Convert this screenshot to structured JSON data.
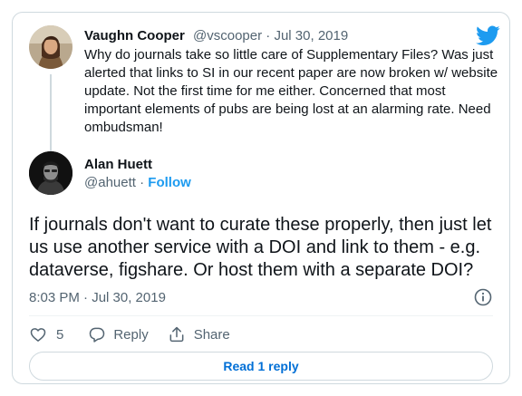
{
  "parent_tweet": {
    "name": "Vaughn Cooper",
    "handle": "@vscooper",
    "separator": " · ",
    "date": "Jul 30, 2019",
    "text": "Why do journals take so little care of Supplementary Files? Was just alerted that links to SI in our recent paper are now broken w/ website update. Not the first time for me either. Concerned that most important elements of pubs are being lost at an alarming rate. Need ombudsman!"
  },
  "main_tweet": {
    "name": "Alan Huett",
    "handle": "@ahuett",
    "separator": " · ",
    "follow_label": "Follow",
    "text": "If journals don't want to curate these properly, then just let us use another service with a DOI and link to them - e.g. dataverse, figshare. Or host them with a separate DOI?",
    "timestamp": "8:03 PM · Jul 30, 2019"
  },
  "actions": {
    "like_count": "5",
    "reply_label": "Reply",
    "share_label": "Share"
  },
  "read_replies_label": "Read 1 reply",
  "colors": {
    "brand_blue": "#1d9bf0",
    "link_blue": "#006fd6",
    "muted_text": "#536471",
    "border": "#cfd9de"
  },
  "icons": {
    "brand": "twitter-bird-icon",
    "info": "info-icon",
    "like": "heart-icon",
    "reply": "speech-bubble-icon",
    "share": "share-arrow-icon"
  }
}
